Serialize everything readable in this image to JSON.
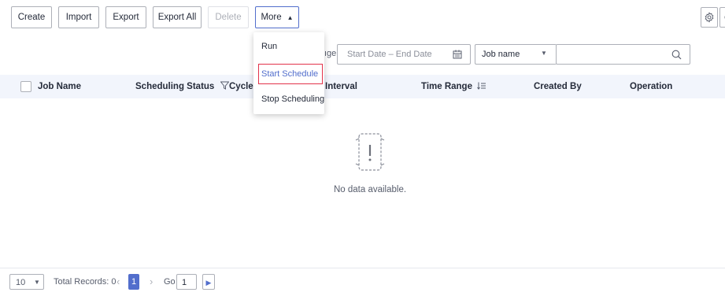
{
  "toolbar": {
    "create": "Create",
    "import": "Import",
    "export": "Export",
    "export_all": "Export All",
    "delete": "Delete",
    "more": "More",
    "more_caret": "▲"
  },
  "more_menu": {
    "items": [
      "Run",
      "Start Schedule",
      "Stop Scheduling"
    ],
    "highlighted": "Start Schedule"
  },
  "filters": {
    "date_label_partial": "ıge",
    "date_placeholder": "Start Date – End Date",
    "search_type": "Job name",
    "search_caret": "▼"
  },
  "table": {
    "columns": [
      "Job Name",
      "Scheduling Status",
      "Cycle",
      "Interval",
      "Time Range",
      "Created By",
      "Operation"
    ],
    "empty_text": "No data available."
  },
  "pagination": {
    "page_size": "10",
    "total_records": "Total Records: 0",
    "current_page": "1",
    "go_label": "Go",
    "go_value": "1"
  },
  "colors": {
    "primary": "#526ecc",
    "highlight_border": "#e3334b",
    "header_bg": "#f2f5fc",
    "border": "#adb0b8"
  }
}
